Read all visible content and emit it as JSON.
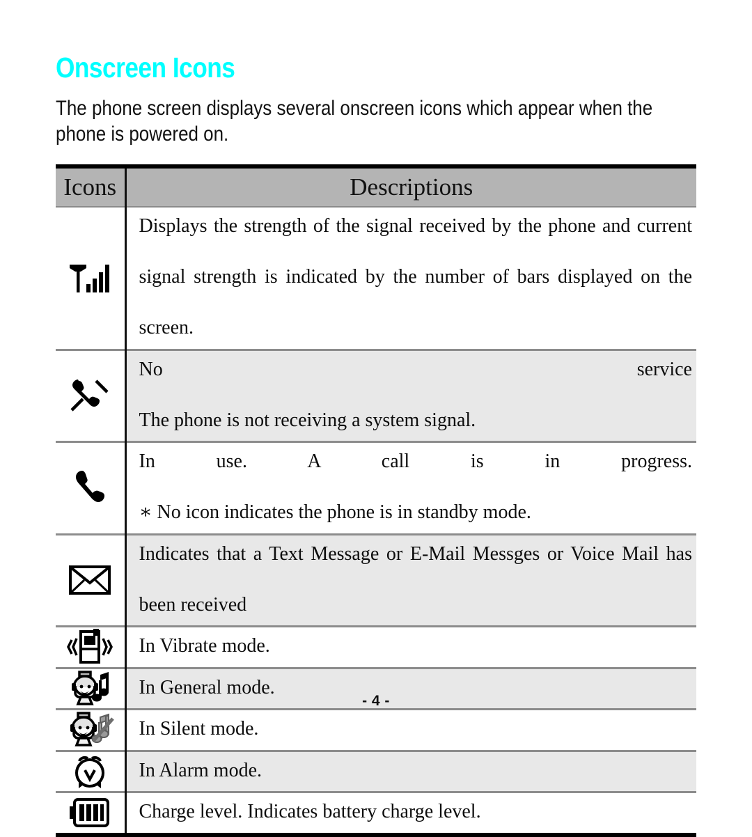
{
  "document": {
    "title": "Onscreen Icons",
    "title_color": "#00ffff",
    "intro": "The phone screen displays several onscreen icons which appear when the phone is powered on.",
    "page_number": "- 4 -"
  },
  "table": {
    "columns": [
      "Icons",
      "Descriptions"
    ],
    "header_background": "#b4b4b4",
    "shaded_row_background": "#e8e8e8",
    "rows": [
      {
        "icon": "signal-strength-icon",
        "shaded": false,
        "lines": [
          "Displays the strength of the signal received by the phone and current",
          "signal strength is indicated by the number of bars displayed on the",
          "screen."
        ]
      },
      {
        "icon": "no-service-phone-icon",
        "shaded": true,
        "lines": [
          "No service",
          "The phone is not receiving a system signal."
        ]
      },
      {
        "icon": "in-use-phone-icon",
        "shaded": false,
        "lines": [
          "In use. A call is in progress.",
          "∗ No icon indicates the phone is in standby mode."
        ]
      },
      {
        "icon": "envelope-message-icon",
        "shaded": true,
        "lines": [
          "Indicates that a Text Message or E-Mail Messges or Voice Mail has",
          "been received"
        ]
      },
      {
        "icon": "vibrate-mode-icon",
        "shaded": false,
        "lines": [
          "In Vibrate mode."
        ]
      },
      {
        "icon": "general-mode-icon",
        "shaded": true,
        "lines": [
          "In General mode."
        ]
      },
      {
        "icon": "silent-mode-icon",
        "shaded": false,
        "lines": [
          "In Silent mode."
        ]
      },
      {
        "icon": "alarm-mode-icon",
        "shaded": true,
        "lines": [
          "In Alarm mode."
        ]
      },
      {
        "icon": "battery-charge-icon",
        "shaded": false,
        "lines": [
          "Charge level. Indicates battery charge level."
        ]
      }
    ]
  }
}
